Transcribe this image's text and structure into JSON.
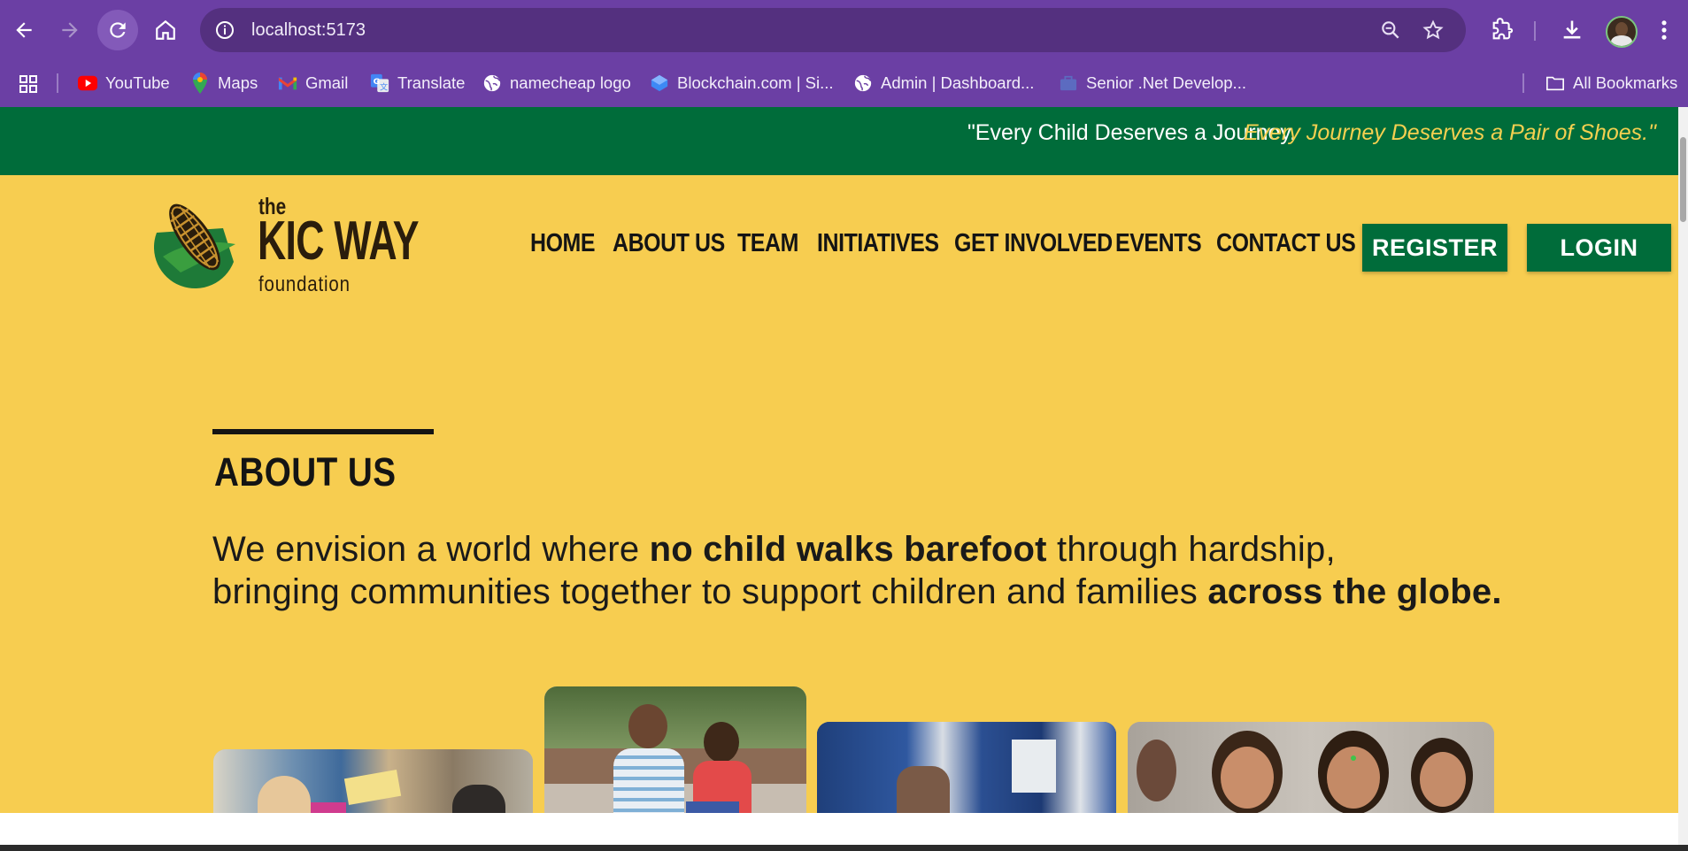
{
  "browser": {
    "url": "localhost:5173",
    "back_icon": "arrow-left-icon",
    "forward_icon": "arrow-right-icon",
    "reload_icon": "reload-icon",
    "home_icon": "home-icon",
    "bookmarks": [
      {
        "label": "YouTube",
        "icon": "youtube-icon"
      },
      {
        "label": "Maps",
        "icon": "maps-icon"
      },
      {
        "label": "Gmail",
        "icon": "gmail-icon"
      },
      {
        "label": "Translate",
        "icon": "translate-icon"
      },
      {
        "label": "namecheap logo",
        "icon": "globe-icon"
      },
      {
        "label": "Blockchain.com | Si...",
        "icon": "blockchain-icon"
      },
      {
        "label": "Admin | Dashboard...",
        "icon": "globe-icon"
      },
      {
        "label": "Senior .Net Develop...",
        "icon": "briefcase-icon"
      }
    ],
    "all_bookmarks": "All Bookmarks"
  },
  "site": {
    "tagline_part1": "\"Every Child Deserves a Journey.",
    "tagline_part2": "Every Journey Deserves a Pair of Shoes.\"",
    "logo": {
      "the": "the",
      "name": "KIC WAY",
      "foundation": "foundation"
    },
    "nav": [
      "HOME",
      "ABOUT US",
      "TEAM",
      "INITIATIVES",
      "GET INVOLVED",
      "EVENTS",
      "CONTACT US"
    ],
    "register": "REGISTER",
    "login": "LOGIN",
    "about": {
      "title": "ABOUT US",
      "line1_a": "We envision a world where ",
      "line1_b": "no child walks barefoot",
      "line1_c": " through hardship,",
      "line2_a": "bringing communities together to support children and families ",
      "line2_b": "across the globe."
    }
  },
  "colors": {
    "chrome": "#6b3fa4",
    "banner_green": "#006c3a",
    "page_yellow": "#f7cd50",
    "tagline_yellow": "#f4d050"
  }
}
